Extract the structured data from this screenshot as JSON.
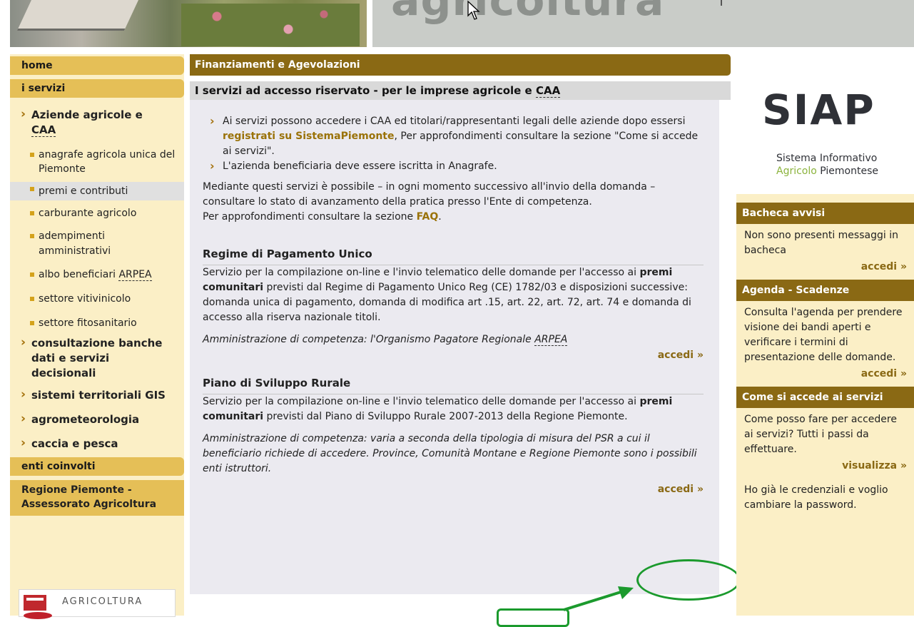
{
  "header": {
    "title": "agricoltura"
  },
  "leftnav": {
    "home": "home",
    "servizi": "i servizi",
    "aziende_line1": "Aziende agricole e",
    "aziende_abbr": "CAA",
    "sub_items": [
      "anagrafe agricola unica del Piemonte",
      "premi e contributi",
      "carburante agricolo",
      "adempimenti amministrativi",
      "albo beneficiari",
      "settore vitivinicolo",
      "settore fitosanitario"
    ],
    "albo_abbr": "ARPEA",
    "top_items": [
      "consultazione banche dati e servizi decisionali",
      "sistemi territoriali GIS",
      "agrometeorologia",
      "caccia e pesca"
    ],
    "enti": "enti coinvolti",
    "region": "Regione Piemonte - Assessorato Agricoltura",
    "logo_text": "AGRICOLTURA"
  },
  "main": {
    "bar1": "Finanziamenti e Agevolazioni",
    "bar2_text": "I servizi ad accesso riservato - per le imprese agricole e",
    "bar2_abbr": "CAA",
    "bullet1_a": "Ai servizi possono accedere i CAA ed titolari/rappresentanti legali delle aziende dopo essersi",
    "bullet1_link": "registrati su SistemaPiemonte",
    "bullet1_b": ", Per approfondimenti consultare la sezione \"Come si accede ai servizi\".",
    "bullet2": "L'azienda beneficiaria deve essere iscritta in Anagrafe.",
    "intro_a": "Mediante questi servizi è possibile – in ogni momento successivo all'invio della domanda – consultare lo stato di avanzamento della pratica presso l'Ente di competenza.",
    "intro_b": "Per approfondimenti consultare la sezione",
    "intro_faq": "FAQ",
    "s1_title": "Regime di Pagamento Unico",
    "s1_body_a": "Servizio per la compilazione on-line e l'invio telematico delle domande per l'accesso ai",
    "s1_bold": "premi comunitari",
    "s1_body_b": "previsti dal Regime di Pagamento Unico Reg (CE) 1782/03 e disposizioni successive: domanda unica di pagamento, domanda di modifica art .15, art. 22, art. 72, art. 74  e   domanda di accesso alla riserva nazionale titoli.",
    "s1_admin": "Amministrazione di competenza: l'Organismo Pagatore Regionale",
    "s1_abbr": "ARPEA",
    "s1_link": "accedi »",
    "s2_title": "Piano di Sviluppo Rurale",
    "s2_body_a": "Servizio per la compilazione on-line e l'invio telematico delle domande per l'accesso ai",
    "s2_bold": "premi comunitari",
    "s2_body_b": "previsti dal Piano di Sviluppo Rurale 2007-2013 della Regione Piemonte.",
    "s2_admin": "Amministrazione di competenza: varia a seconda della tipologia di misura del PSR a cui il beneficiario richiede di accedere. Province, Comunità Montane e Regione Piemonte sono i possibili enti istruttori.",
    "s2_link": "accedi »"
  },
  "right": {
    "siap_word": "SIAP",
    "siap_sub1": "Sistema Informativo",
    "siap_sub2a": "Agricolo",
    "siap_sub2b": "Piemontese",
    "bacheca_title": "Bacheca avvisi",
    "bacheca_body": "Non sono presenti messaggi in bacheca",
    "bacheca_link": "accedi »",
    "agenda_title": "Agenda - Scadenze",
    "agenda_body": "Consulta l'agenda per prendere visione dei bandi aperti e verificare i termini di presentazione delle domande.",
    "agenda_link": "accedi »",
    "accesso_title": "Come si accede ai servizi",
    "accesso_body": "Come posso fare per accedere ai servizi? Tutti i passi da effettuare.",
    "accesso_link": "visualizza »",
    "cred_body": "Ho già le credenziali e voglio cambiare la password."
  },
  "colors": {
    "brown": "#8a6914",
    "gold": "#e5bf57",
    "cream": "#fbefc6",
    "annotation_green": "#1b9a2d"
  }
}
